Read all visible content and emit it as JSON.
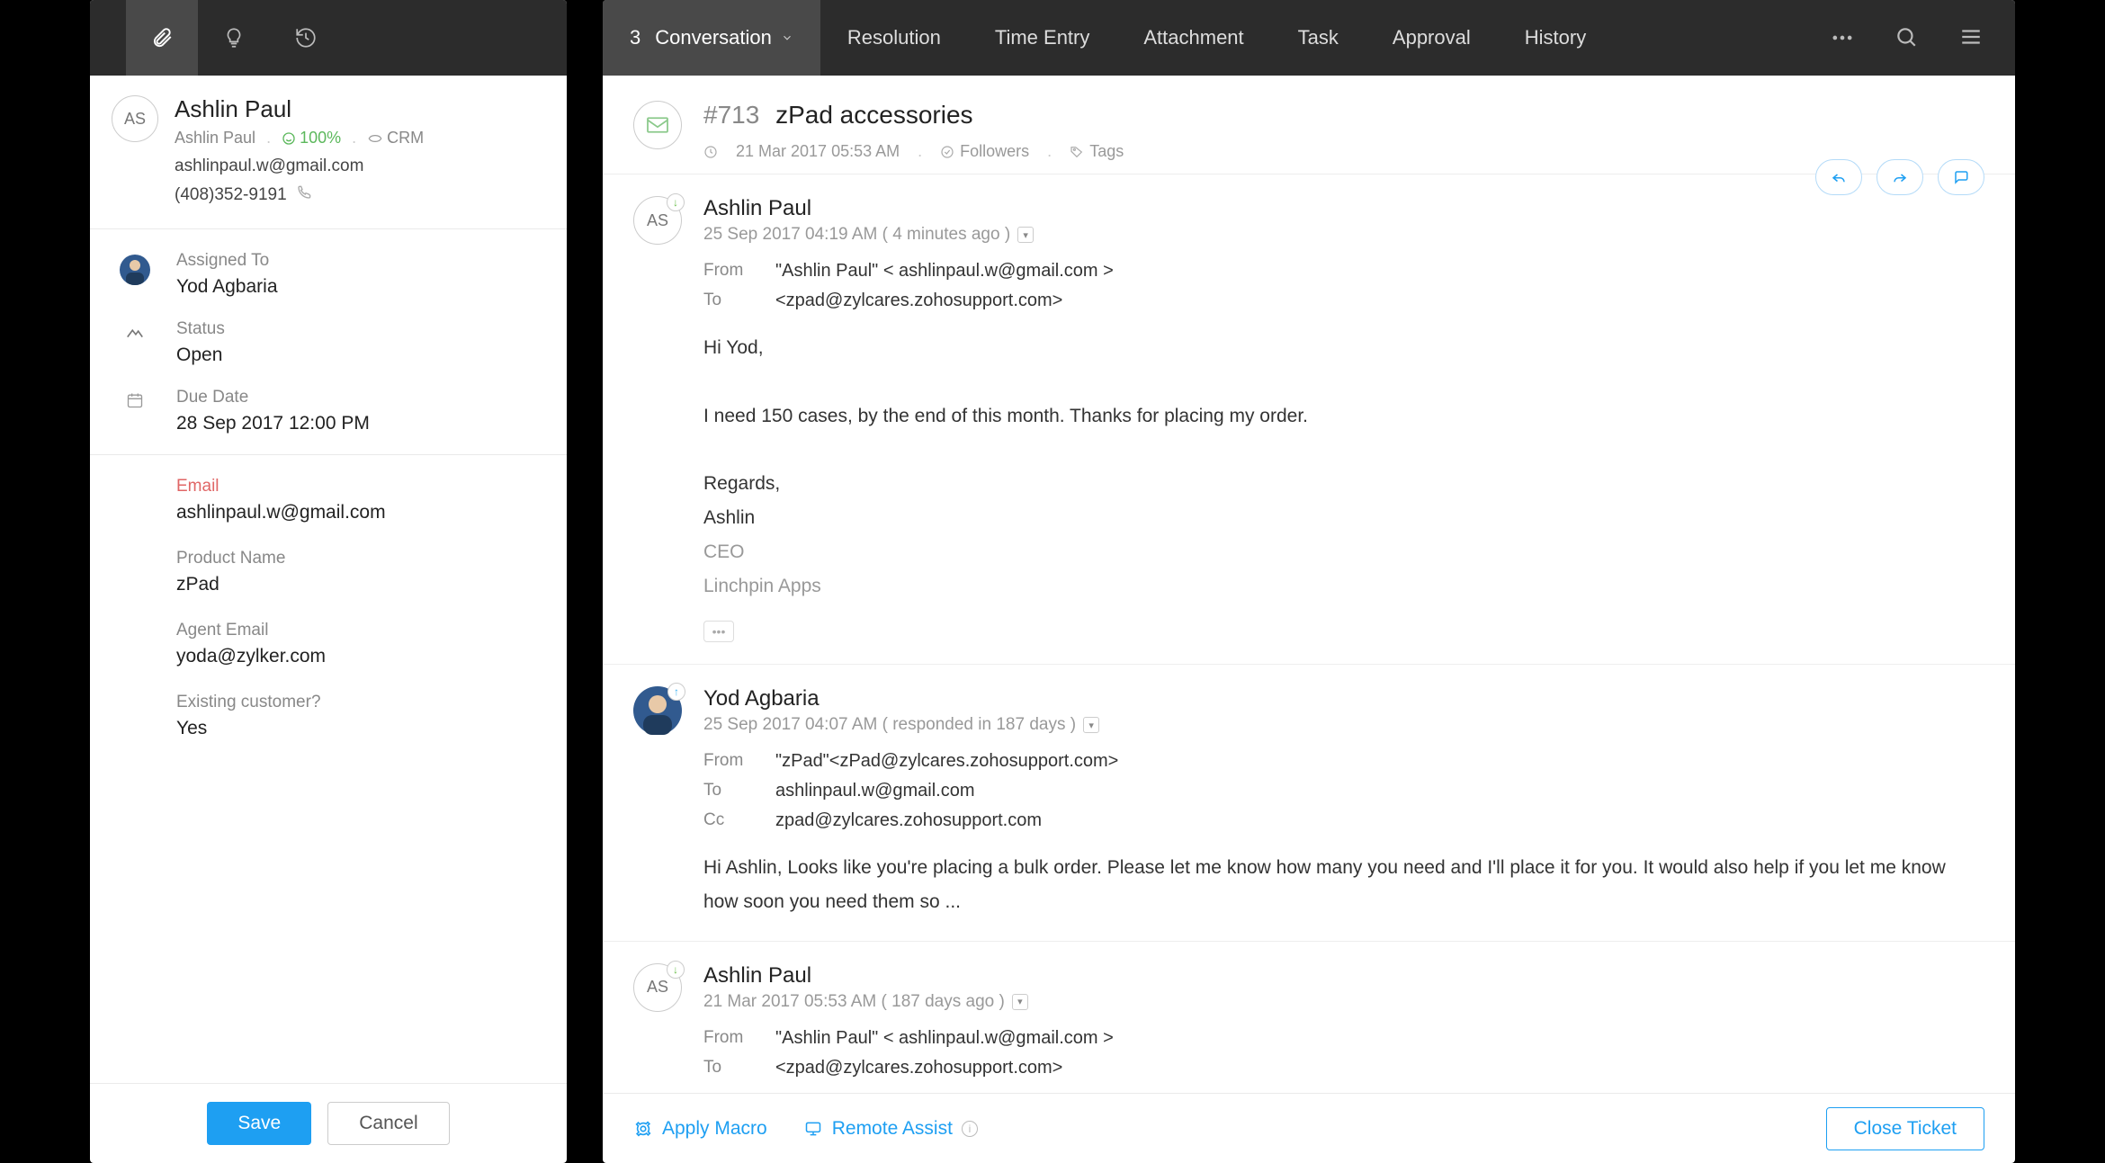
{
  "requester": {
    "initials": "AS",
    "name": "Ashlin Paul",
    "displayName": "Ashlin Paul",
    "score": "100%",
    "crm": "CRM",
    "email": "ashlinpaul.w@gmail.com",
    "phone": "(408)352-9191"
  },
  "props": {
    "assignedToLabel": "Assigned To",
    "assignedTo": "Yod Agbaria",
    "statusLabel": "Status",
    "status": "Open",
    "dueDateLabel": "Due Date",
    "dueDate": "28 Sep 2017 12:00 PM"
  },
  "fields": {
    "emailLabel": "Email",
    "email": "ashlinpaul.w@gmail.com",
    "productLabel": "Product Name",
    "product": "zPad",
    "agentEmailLabel": "Agent Email",
    "agentEmail": "yoda@zylker.com",
    "existingLabel": "Existing customer?",
    "existing": "Yes"
  },
  "leftButtons": {
    "save": "Save",
    "cancel": "Cancel"
  },
  "nav": {
    "count": "3",
    "tabs": [
      "Conversation",
      "Resolution",
      "Time Entry",
      "Attachment",
      "Task",
      "Approval",
      "History"
    ]
  },
  "ticket": {
    "id": "#713",
    "subject": "zPad accessories",
    "datetime": "21 Mar 2017 05:53 AM",
    "followers": "Followers",
    "tags": "Tags"
  },
  "messages": [
    {
      "initials": "AS",
      "name": "Ashlin Paul",
      "time": "25 Sep 2017 04:19 AM ( 4 minutes ago )",
      "direction": "in",
      "from": "\"Ashlin Paul\" < ashlinpaul.w@gmail.com >",
      "to": "<zpad@zylcares.zohosupport.com>",
      "body": [
        "Hi Yod,",
        "I need 150 cases, by the end of this month. Thanks for placing my order.",
        "Regards,",
        "Ashlin"
      ],
      "sigGray": [
        "CEO",
        "Linchpin Apps"
      ]
    },
    {
      "avatar": "agent",
      "name": "Yod Agbaria",
      "time": "25 Sep 2017 04:07 AM ( responded in 187 days )",
      "direction": "out",
      "from": "\"zPad\"<zPad@zylcares.zohosupport.com>",
      "to": "ashlinpaul.w@gmail.com",
      "cc": "zpad@zylcares.zohosupport.com",
      "body": [
        "Hi Ashlin, Looks like you're placing a bulk order. Please let me know how many you need and I'll place it for you. It would also help if you let me know how soon you need them so ..."
      ]
    },
    {
      "initials": "AS",
      "name": "Ashlin Paul",
      "time": "21 Mar 2017 05:53 AM ( 187 days ago )",
      "direction": "in",
      "from": "\"Ashlin Paul\" < ashlinpaul.w@gmail.com >",
      "to": "<zpad@zylcares.zohosupport.com>"
    }
  ],
  "footer": {
    "applyMacro": "Apply Macro",
    "remoteAssist": "Remote Assist",
    "closeTicket": "Close Ticket"
  },
  "hdrLabels": {
    "from": "From",
    "to": "To",
    "cc": "Cc"
  }
}
